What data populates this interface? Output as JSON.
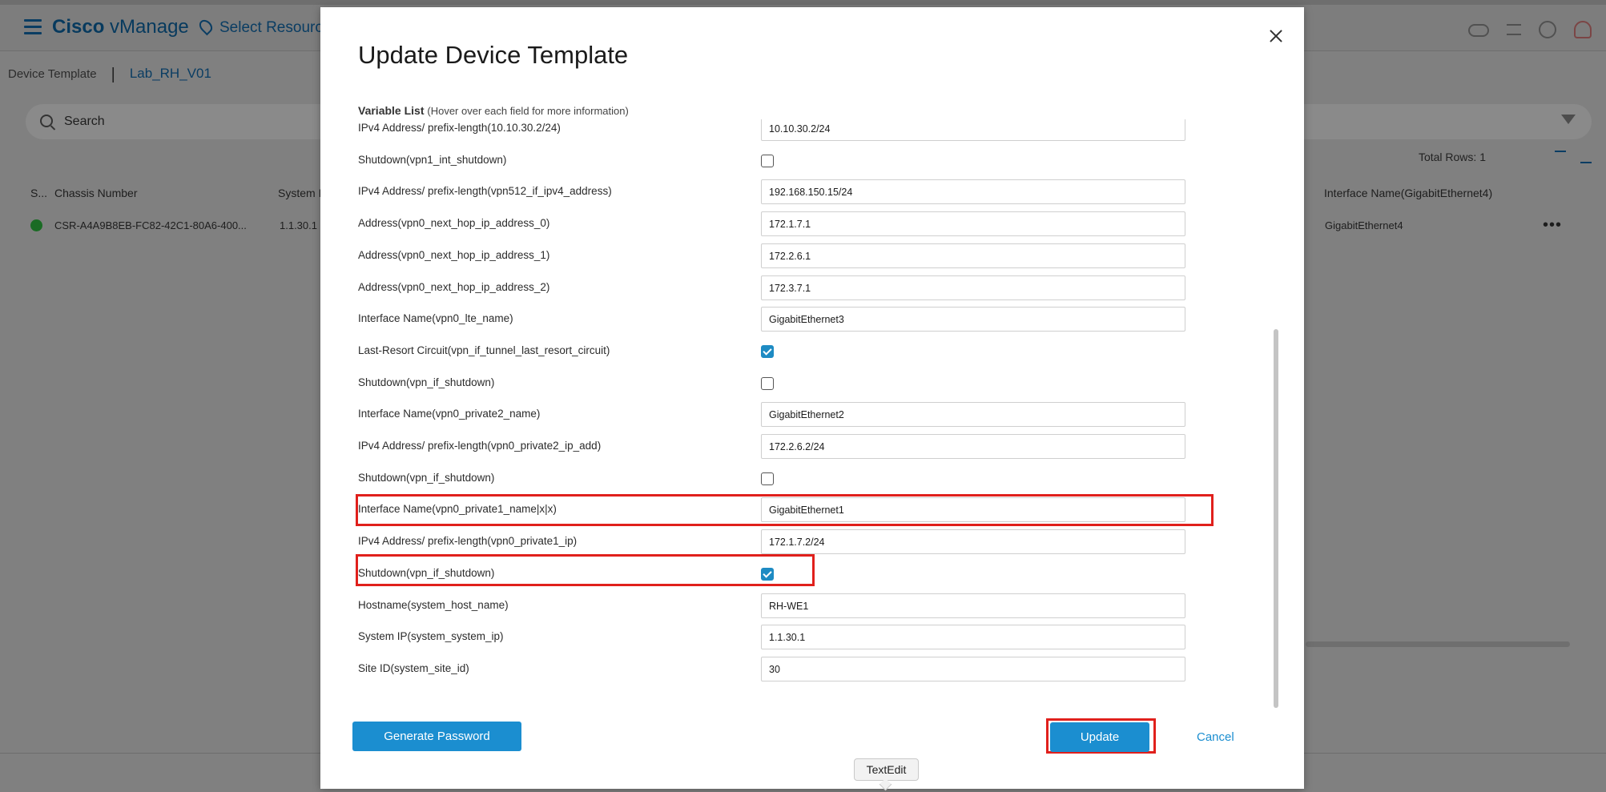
{
  "app": {
    "brand_bold": "Cisco",
    "brand_rest": " vManage",
    "select_resource": "Select Resource"
  },
  "breadcrumb": {
    "parent": "Device Template",
    "current": "Lab_RH_V01"
  },
  "search": {
    "placeholder": "Search"
  },
  "table": {
    "total_rows": "Total Rows: 1",
    "headers": [
      "S...",
      "Chassis Number",
      "System I",
      "Interface Name(GigabitEthernet4)"
    ],
    "row": {
      "chassis": "CSR-A4A9B8EB-FC82-42C1-80A6-400...",
      "system_ip": "1.1.30.1",
      "interface": "GigabitEthernet4",
      "more": "•••"
    }
  },
  "modal": {
    "title": "Update Device Template",
    "variable_list_title": "Variable List",
    "variable_list_hint": "(Hover over each field for more information)",
    "variables": [
      {
        "label": "IPv4 Address/ prefix-length(10.10.30.2/24)",
        "type": "text",
        "value": "10.10.30.2/24"
      },
      {
        "label": "Shutdown(vpn1_int_shutdown)",
        "type": "checkbox",
        "checked": false
      },
      {
        "label": "IPv4 Address/ prefix-length(vpn512_if_ipv4_address)",
        "type": "text",
        "value": "192.168.150.15/24"
      },
      {
        "label": "Address(vpn0_next_hop_ip_address_0)",
        "type": "text",
        "value": "172.1.7.1"
      },
      {
        "label": "Address(vpn0_next_hop_ip_address_1)",
        "type": "text",
        "value": "172.2.6.1"
      },
      {
        "label": "Address(vpn0_next_hop_ip_address_2)",
        "type": "text",
        "value": "172.3.7.1"
      },
      {
        "label": "Interface Name(vpn0_lte_name)",
        "type": "text",
        "value": "GigabitEthernet3"
      },
      {
        "label": "Last-Resort Circuit(vpn_if_tunnel_last_resort_circuit)",
        "type": "checkbox",
        "checked": true
      },
      {
        "label": "Shutdown(vpn_if_shutdown)",
        "type": "checkbox",
        "checked": false
      },
      {
        "label": "Interface Name(vpn0_private2_name)",
        "type": "text",
        "value": "GigabitEthernet2"
      },
      {
        "label": "IPv4 Address/ prefix-length(vpn0_private2_ip_add)",
        "type": "text",
        "value": "172.2.6.2/24"
      },
      {
        "label": "Shutdown(vpn_if_shutdown)",
        "type": "checkbox",
        "checked": false
      },
      {
        "label": "Interface Name(vpn0_private1_name|x|x)",
        "type": "text",
        "value": "GigabitEthernet1"
      },
      {
        "label": "IPv4 Address/ prefix-length(vpn0_private1_ip)",
        "type": "text",
        "value": "172.1.7.2/24"
      },
      {
        "label": "Shutdown(vpn_if_shutdown)",
        "type": "checkbox",
        "checked": true
      },
      {
        "label": "Hostname(system_host_name)",
        "type": "text",
        "value": "RH-WE1"
      },
      {
        "label": "System IP(system_system_ip)",
        "type": "text",
        "value": "1.1.30.1"
      },
      {
        "label": "Site ID(system_site_id)",
        "type": "text",
        "value": "30"
      }
    ],
    "generate_password_label": "Generate Password",
    "update_label": "Update",
    "cancel_label": "Cancel"
  },
  "tooltip": {
    "text": "TextEdit"
  },
  "colors": {
    "accent": "#1b8ed0",
    "highlight": "#e0201c"
  }
}
